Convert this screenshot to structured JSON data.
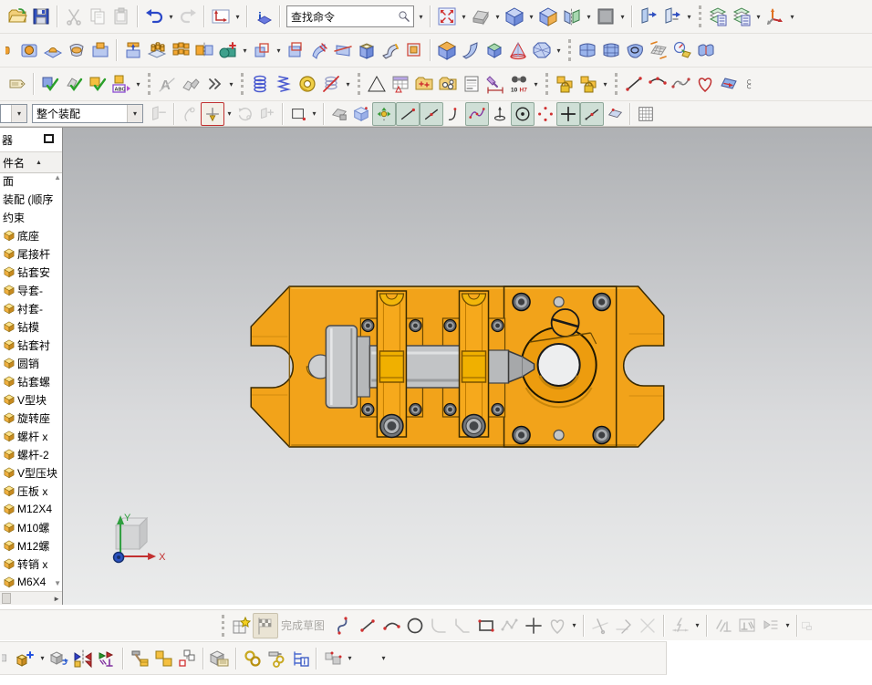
{
  "colors": {
    "model_orange": "#f2a31a",
    "model_gold": "#f0b000",
    "shaft_gray": "#c2c4c6",
    "viewport_top": "#afb1b4",
    "viewport_bottom": "#ebecec",
    "snap_active_bg": "#cfdfd6"
  },
  "search": {
    "value": "查找命令"
  },
  "toolbars": {
    "row1": [
      {
        "n": "open",
        "t": "folder"
      },
      {
        "n": "save",
        "t": "floppy"
      },
      {
        "t": "sep"
      },
      {
        "n": "cut",
        "t": "scissors",
        "gray": true
      },
      {
        "n": "copy",
        "t": "copy",
        "gray": true
      },
      {
        "n": "paste",
        "t": "paste",
        "gray": true
      },
      {
        "t": "sep"
      },
      {
        "n": "undo",
        "t": "undo",
        "dd": true
      },
      {
        "n": "redo",
        "t": "redo",
        "gray": true
      },
      {
        "t": "sep"
      },
      {
        "n": "view-orientation",
        "t": "axesbox",
        "dd": true
      },
      {
        "t": "sep"
      },
      {
        "n": "assembly-information",
        "t": "info"
      },
      {
        "t": "sep"
      },
      {
        "n": "command-finder",
        "t": "search",
        "dd": true
      },
      {
        "t": "sep"
      },
      {
        "n": "fit-view",
        "t": "fit",
        "dd": true
      },
      {
        "n": "view-trimetric",
        "t": "viewgray",
        "dd": true
      },
      {
        "n": "view-isometric",
        "t": "cube",
        "dd": true
      },
      {
        "n": "half-section",
        "t": "halfsection"
      },
      {
        "n": "edit-section",
        "t": "clipsection",
        "dd": true
      },
      {
        "n": "display-style",
        "t": "graysquare",
        "dd": true
      },
      {
        "t": "sep"
      },
      {
        "n": "move-to-layer",
        "t": "platearrow"
      },
      {
        "n": "layer-visible-in-view",
        "t": "platearrow2",
        "dd": true
      },
      {
        "t": "drag"
      },
      {
        "n": "layer-settings",
        "t": "layers"
      },
      {
        "n": "layer-category",
        "t": "layers",
        "dd": true
      },
      {
        "n": "wcs-orient",
        "t": "triad",
        "dd": true
      }
    ],
    "row2": [
      {
        "n": "blend-clipped",
        "t": "holehalf",
        "clipL": true
      },
      {
        "n": "hole",
        "t": "hole"
      },
      {
        "n": "boss",
        "t": "boss"
      },
      {
        "n": "pocket",
        "t": "pocket"
      },
      {
        "n": "pad",
        "t": "pad"
      },
      {
        "t": "sep"
      },
      {
        "n": "datum-extrude",
        "t": "extrtable"
      },
      {
        "n": "instance-array",
        "t": "pattern"
      },
      {
        "n": "pattern-feature",
        "t": "patterncubes"
      },
      {
        "n": "mirror-feature",
        "t": "mirrorf"
      },
      {
        "n": "boolean-operation",
        "t": "boolplus",
        "dd": true
      },
      {
        "n": "unite",
        "t": "unite",
        "dd": true
      },
      {
        "n": "subtract",
        "t": "subtract"
      },
      {
        "n": "sweep-along-guide",
        "t": "sweepsheet"
      },
      {
        "n": "trim-body",
        "t": "trimsheet"
      },
      {
        "n": "shell",
        "t": "shellbox"
      },
      {
        "n": "sheet-to-solid",
        "t": "bendsheet"
      },
      {
        "n": "offset-region",
        "t": "dashedcube"
      },
      {
        "t": "sep"
      },
      {
        "n": "chamfer",
        "t": "chamferbox"
      },
      {
        "n": "ruled-blade",
        "t": "bentblade"
      },
      {
        "n": "tapered-body",
        "t": "greenbox"
      },
      {
        "n": "cone",
        "t": "cone"
      },
      {
        "n": "convex-body",
        "t": "polysphere",
        "dd": true
      },
      {
        "t": "drag"
      },
      {
        "n": "four-point-surface",
        "t": "patch4"
      },
      {
        "n": "through-mesh",
        "t": "meshsurf"
      },
      {
        "n": "n-sided-surface",
        "t": "nsided"
      },
      {
        "n": "swept-surface",
        "t": "sweptmesh"
      },
      {
        "n": "curve-analysis",
        "t": "curvemeter"
      },
      {
        "n": "sew-surface",
        "t": "stitched"
      }
    ],
    "row3": [
      {
        "n": "annotation-note",
        "t": "note"
      },
      {
        "t": "sep"
      },
      {
        "n": "examine-geometry",
        "t": "checkpart"
      },
      {
        "n": "check-section",
        "t": "checkfeat"
      },
      {
        "n": "check-solid",
        "t": "checkcube"
      },
      {
        "n": "label-notes",
        "t": "abccube",
        "txt": [
          "ABC"
        ],
        "dd": true
      },
      {
        "t": "drag"
      },
      {
        "n": "draft-analysis",
        "t": "draftA"
      },
      {
        "n": "face-analysis",
        "t": "wedge2"
      },
      {
        "n": "more-commands",
        "t": "chevron2",
        "dd": true
      },
      {
        "t": "drag"
      },
      {
        "n": "coil",
        "t": "coil"
      },
      {
        "n": "spring",
        "t": "spring"
      },
      {
        "n": "washer",
        "t": "washer"
      },
      {
        "n": "suppress-spring",
        "t": "nocoil",
        "dd": true
      },
      {
        "t": "drag"
      },
      {
        "n": "triangle-prism",
        "t": "triangle"
      },
      {
        "n": "part-family-table",
        "t": "tableicon"
      },
      {
        "n": "point-group",
        "t": "folderpts"
      },
      {
        "n": "hole-series",
        "t": "foldercirc"
      },
      {
        "n": "text-note",
        "t": "textpage"
      },
      {
        "n": "dimension-style",
        "t": "brushdim"
      },
      {
        "n": "fit-tolerance",
        "t": "binoc",
        "txt": [
          "10",
          "H7"
        ],
        "dd": true
      },
      {
        "t": "drag"
      },
      {
        "n": "lock-position",
        "t": "lockcube"
      },
      {
        "n": "lock-constraints",
        "t": "lockcube",
        "dd": true
      },
      {
        "t": "drag"
      },
      {
        "n": "basic-line",
        "t": "lineseg"
      },
      {
        "n": "basic-arc",
        "t": "arcseg"
      },
      {
        "n": "studio-spline",
        "t": "splinepts"
      },
      {
        "n": "artistic-curve",
        "t": "heart"
      },
      {
        "n": "face-blend-strip",
        "t": "surfstrip"
      },
      {
        "n": "clipped-right",
        "t": "partialC",
        "clipR": true
      }
    ],
    "row4": [
      {
        "n": "type-filter",
        "t": "select",
        "v": "",
        "w": 30,
        "clipL": true
      },
      {
        "n": "selection-scope",
        "t": "select",
        "v": "整个装配",
        "w": 122
      },
      {
        "n": "interpart-navigator",
        "t": "graylink",
        "gray": true
      },
      {
        "t": "sep"
      },
      {
        "n": "move-component-hand",
        "t": "grayhand",
        "gray": true
      },
      {
        "n": "selection-filter",
        "t": "movefilter",
        "hl": true,
        "dd": true
      },
      {
        "n": "rotate-component",
        "t": "rotgray",
        "gray": true
      },
      {
        "n": "drag-component",
        "t": "movegray2",
        "gray": true
      },
      {
        "t": "sep"
      },
      {
        "n": "rectangle-select",
        "t": "marquee",
        "dd": true
      },
      {
        "t": "sep"
      },
      {
        "n": "highlight-shaded",
        "t": "shadegray"
      },
      {
        "n": "clipping-cube",
        "t": "bluecube2"
      },
      {
        "n": "snap-point-enable",
        "t": "snapon",
        "sel": true
      },
      {
        "n": "snap-endpoint",
        "t": "snapend",
        "sel": true
      },
      {
        "n": "snap-midpoint",
        "t": "snapmid",
        "sel": true
      },
      {
        "n": "snap-tangent-point",
        "t": "snaptan"
      },
      {
        "n": "snap-pole",
        "t": "snapspline",
        "sel": true
      },
      {
        "n": "snap-cone-tip",
        "t": "snapcone"
      },
      {
        "n": "snap-arc-center",
        "t": "snapcenter",
        "sel": true
      },
      {
        "n": "snap-quadrant",
        "t": "snapquad"
      },
      {
        "n": "snap-intersection",
        "t": "snapplus",
        "sel": true
      },
      {
        "n": "snap-point-on-curve",
        "t": "snapponc",
        "sel": true
      },
      {
        "n": "snap-point-on-face",
        "t": "snapsurf"
      },
      {
        "t": "sep"
      },
      {
        "n": "work-grid",
        "t": "gridicon"
      }
    ],
    "sketch": [
      {
        "t": "drag"
      },
      {
        "n": "sketch",
        "t": "sketchstar"
      },
      {
        "n": "finish-sketch",
        "t": "flagicon",
        "label": "完成草图",
        "pressed": true,
        "gray": true
      },
      {
        "n": "profile",
        "t": "profile"
      },
      {
        "n": "sketch-line",
        "t": "skline"
      },
      {
        "n": "sketch-arc",
        "t": "skarc"
      },
      {
        "n": "sketch-circle",
        "t": "skcircle"
      },
      {
        "n": "sketch-fillet",
        "t": "filletg",
        "gray": true
      },
      {
        "n": "sketch-chamfer",
        "t": "chamferg",
        "gray": true
      },
      {
        "n": "sketch-rectangle",
        "t": "skrect"
      },
      {
        "n": "sketch-polygon",
        "t": "polygray",
        "gray": true
      },
      {
        "n": "sketch-point",
        "t": "plusbig"
      },
      {
        "n": "sketch-spline",
        "t": "heartg",
        "dd": true,
        "gray": true
      },
      {
        "t": "sep"
      },
      {
        "n": "quick-trim",
        "t": "trimg",
        "gray": true
      },
      {
        "n": "quick-extend",
        "t": "extendg",
        "gray": true
      },
      {
        "n": "make-corner",
        "t": "cornerg",
        "gray": true
      },
      {
        "t": "sep"
      },
      {
        "n": "auto-dimension",
        "t": "dimflash",
        "dd": true,
        "gray": true
      },
      {
        "t": "sep"
      },
      {
        "n": "parallel-constraint",
        "t": "parperp",
        "gray": true
      },
      {
        "n": "constraint-settings",
        "t": "constrbox",
        "gray": true
      },
      {
        "n": "show-constraints",
        "t": "showconstr",
        "dd": true,
        "gray": true
      },
      {
        "t": "sep"
      },
      {
        "n": "clipped-sketch-right",
        "t": "partialbox",
        "gray": true,
        "clipR": true
      }
    ],
    "assembly": [
      {
        "n": "clipped-left",
        "t": "grayhalf",
        "clipL": true
      },
      {
        "n": "add-component",
        "t": "addcomp",
        "dd": true
      },
      {
        "n": "move-component",
        "t": "movecomp"
      },
      {
        "n": "mirror-assembly",
        "t": "mirrorasm"
      },
      {
        "n": "assembly-constraints",
        "t": "asmconstr"
      },
      {
        "t": "sep"
      },
      {
        "n": "exploded-view",
        "t": "hammercube"
      },
      {
        "n": "component-group",
        "t": "cubes2"
      },
      {
        "n": "assembly-sequence",
        "t": "seqcubes"
      },
      {
        "t": "sep"
      },
      {
        "n": "component-tag",
        "t": "notecube"
      },
      {
        "t": "sep"
      },
      {
        "n": "wave-link",
        "t": "chain"
      },
      {
        "n": "wave-interpart-copy",
        "t": "chainpull"
      },
      {
        "n": "relations-browser",
        "t": "treeinfo"
      },
      {
        "t": "sep"
      },
      {
        "n": "degrees-of-freedom",
        "t": "cubesdots",
        "dd": true
      },
      {
        "n": "toolbar-options",
        "t": "none",
        "dd": true
      }
    ]
  },
  "sidebar": {
    "title_fragment": "器",
    "header_label": "件名",
    "items": [
      {
        "label": "面",
        "cube": false
      },
      {
        "label": "装配 (顺序",
        "cube": false
      },
      {
        "label": "约束",
        "cube": false
      },
      {
        "label": "底座",
        "cube": true
      },
      {
        "label": "尾接杆",
        "cube": true
      },
      {
        "label": "钻套安",
        "cube": true
      },
      {
        "label": "导套-",
        "cube": true
      },
      {
        "label": "衬套-",
        "cube": true
      },
      {
        "label": "钻模",
        "cube": true
      },
      {
        "label": "钻套衬",
        "cube": true
      },
      {
        "label": "圆销",
        "cube": true
      },
      {
        "label": "钻套螺",
        "cube": true
      },
      {
        "label": "V型块",
        "cube": true
      },
      {
        "label": "旋转座",
        "cube": true
      },
      {
        "label": "螺杆 x",
        "cube": true
      },
      {
        "label": "螺杆-2",
        "cube": true
      },
      {
        "label": "V型压块",
        "cube": true
      },
      {
        "label": "压板 x",
        "cube": true
      },
      {
        "label": "M12X4",
        "cube": true
      },
      {
        "label": "M10螺",
        "cube": true
      },
      {
        "label": "M12螺",
        "cube": true
      },
      {
        "label": "转销 x",
        "cube": true
      },
      {
        "label": "M6X4",
        "cube": true
      }
    ]
  },
  "viewport": {
    "wcs_x": "X",
    "wcs_y": "Y"
  }
}
